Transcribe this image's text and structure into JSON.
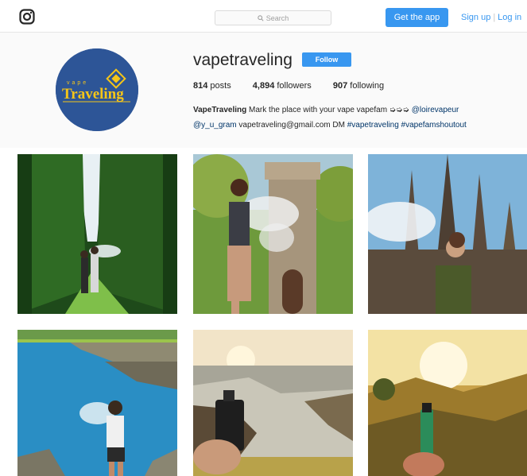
{
  "topbar": {
    "logo_icon": "instagram-camera-icon",
    "search_placeholder": "Search",
    "get_app_label": "Get the app",
    "signup_label": "Sign up",
    "login_label": "Log in",
    "accent_color": "#3897f0"
  },
  "profile": {
    "username": "vapetraveling",
    "follow_label": "Follow",
    "avatar_text_top": "vape",
    "avatar_text_main": "Traveling",
    "stats": {
      "posts_count": "814",
      "posts_label": "posts",
      "followers_count": "4,894",
      "followers_label": "followers",
      "following_count": "907",
      "following_label": "following"
    },
    "bio": {
      "name": "VapeTraveling",
      "line1_text": " Mark the place with your vape vapefam ➭➭➭ ",
      "mention1": "@loirevapeur",
      "mention2": "@y_u_gram",
      "line2_text": " vapetraveling@gmail.com DM ",
      "hashtag1": "#vapetraveling",
      "hashtag2": "#vapefamshoutout"
    }
  },
  "posts": [
    {
      "subject": "hop field couple"
    },
    {
      "subject": "stone tower woman"
    },
    {
      "subject": "sagrada familia man"
    },
    {
      "subject": "sea cliffs man"
    },
    {
      "subject": "coast vape device"
    },
    {
      "subject": "sunset hills vape device"
    }
  ]
}
